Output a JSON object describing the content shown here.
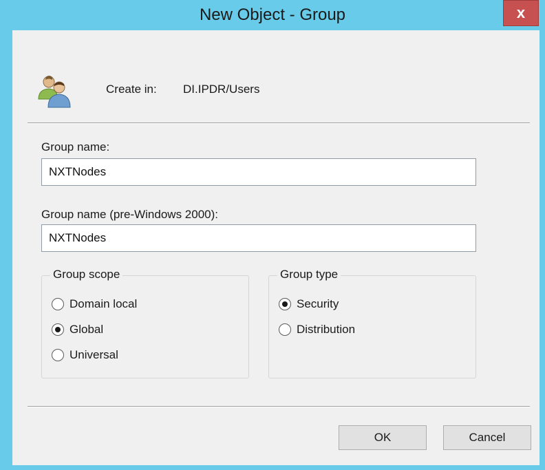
{
  "window": {
    "title": "New Object - Group",
    "close_glyph": "x",
    "titlebar_color": "#68cbea",
    "close_color": "#c75050"
  },
  "header": {
    "icon": "group-users-icon",
    "create_in_label": "Create in:",
    "create_in_value": "DI.IPDR/Users"
  },
  "form": {
    "group_name_label": "Group name:",
    "group_name_value": "NXTNodes",
    "pre2000_label": "Group name (pre-Windows 2000):",
    "pre2000_value": "NXTNodes"
  },
  "group_scope": {
    "title": "Group scope",
    "options": [
      {
        "label": "Domain local",
        "selected": false
      },
      {
        "label": "Global",
        "selected": true
      },
      {
        "label": "Universal",
        "selected": false
      }
    ]
  },
  "group_type": {
    "title": "Group type",
    "options": [
      {
        "label": "Security",
        "selected": true
      },
      {
        "label": "Distribution",
        "selected": false
      }
    ]
  },
  "buttons": {
    "ok_label": "OK",
    "cancel_label": "Cancel"
  }
}
